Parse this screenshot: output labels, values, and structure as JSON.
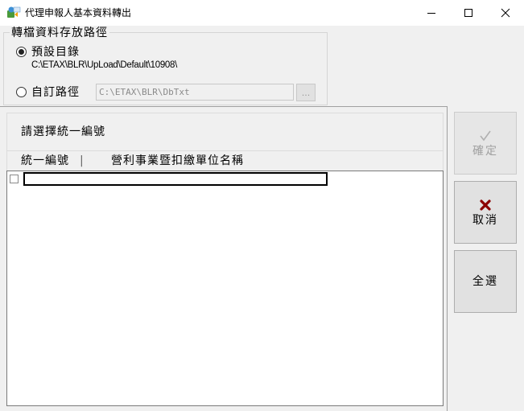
{
  "window": {
    "title": "代理申報人基本資料轉出",
    "icon": "app-logo-icon"
  },
  "path_group": {
    "legend": "轉檔資料存放路徑",
    "default_option_label": "預設目錄",
    "default_option_checked": true,
    "default_path": "C:\\ETAX\\BLR\\UpLoad\\Default\\10908\\",
    "custom_option_label": "自訂路徑",
    "custom_option_checked": false,
    "custom_path_value": "C:\\ETAX\\BLR\\DbTxt",
    "browse_label": "..."
  },
  "list": {
    "title": "請選擇統一編號",
    "columns": [
      "統一編號",
      "營利事業暨扣繳單位名稱"
    ],
    "column_separator": "|",
    "rows": [
      {
        "checked": false,
        "id": "",
        "name": ""
      }
    ]
  },
  "buttons": {
    "confirm_label": "確定",
    "confirm_enabled": false,
    "cancel_label": "取消",
    "select_all_label": "全選"
  },
  "colors": {
    "cancel_icon": "#8b0000",
    "background": "#f0f0f0"
  }
}
